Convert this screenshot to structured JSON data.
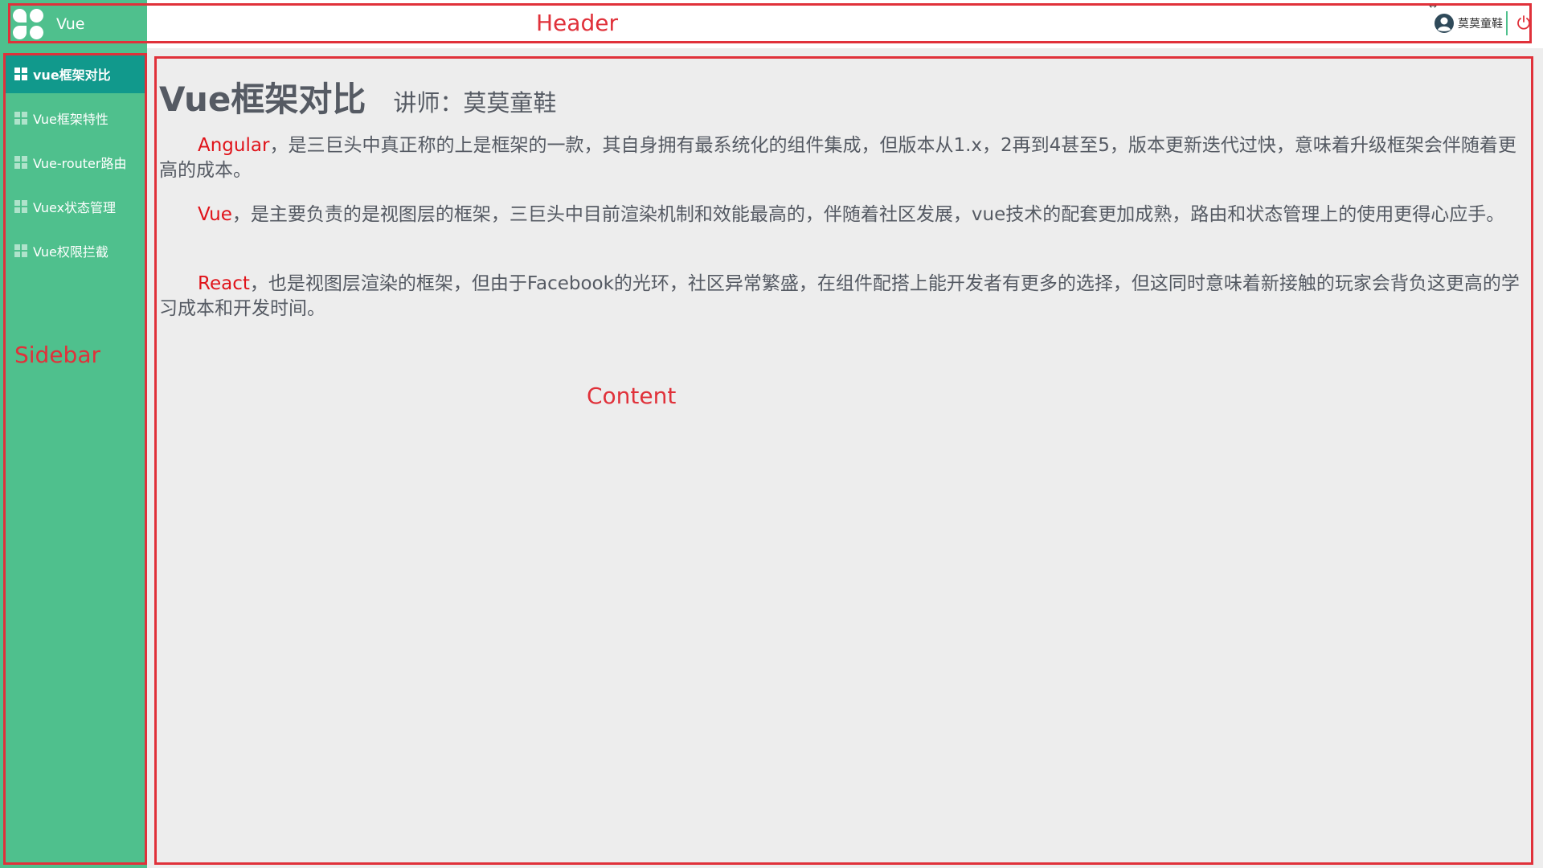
{
  "header": {
    "logo_text": "Vue",
    "annotation": "Header",
    "user_name": "莫莫童鞋",
    "icons": {
      "logo": "vue-logo-icon",
      "user": "user-avatar-icon",
      "power": "power-icon",
      "resize": "resize-arrows-icon"
    }
  },
  "sidebar": {
    "annotation": "Sidebar",
    "items": [
      {
        "label": "vue框架对比",
        "active": true
      },
      {
        "label": "Vue框架特性",
        "active": false
      },
      {
        "label": "Vue-router路由",
        "active": false
      },
      {
        "label": "Vuex状态管理",
        "active": false
      },
      {
        "label": "Vue权限拦截",
        "active": false
      }
    ]
  },
  "content": {
    "annotation": "Content",
    "title": "Vue框架对比",
    "lecturer": "讲师：莫莫童鞋",
    "paragraphs": [
      {
        "keyword": "Angular",
        "text": "，是三巨头中真正称的上是框架的一款，其自身拥有最系统化的组件集成，但版本从1.x，2再到4甚至5，版本更新迭代过快，意味着升级框架会伴随着更高的成本。"
      },
      {
        "keyword": "Vue",
        "text": "，是主要负责的是视图层的框架，三巨头中目前渲染机制和效能最高的，伴随着社区发展，vue技术的配套更加成熟，路由和状态管理上的使用更得心应手。"
      },
      {
        "keyword": "React",
        "text": "，也是视图层渲染的框架，但由于Facebook的光环，社区异常繁盛，在组件配搭上能开发者有更多的选择，但这同时意味着新接触的玩家会背负这更高的学习成本和开发时间。"
      }
    ]
  },
  "colors": {
    "brand_green": "#4fc08d",
    "active_item": "#11998c",
    "annotation_red": "#e0313a",
    "keyword_red": "#e0131a",
    "text_gray": "#555a63",
    "content_bg": "#ededed"
  }
}
